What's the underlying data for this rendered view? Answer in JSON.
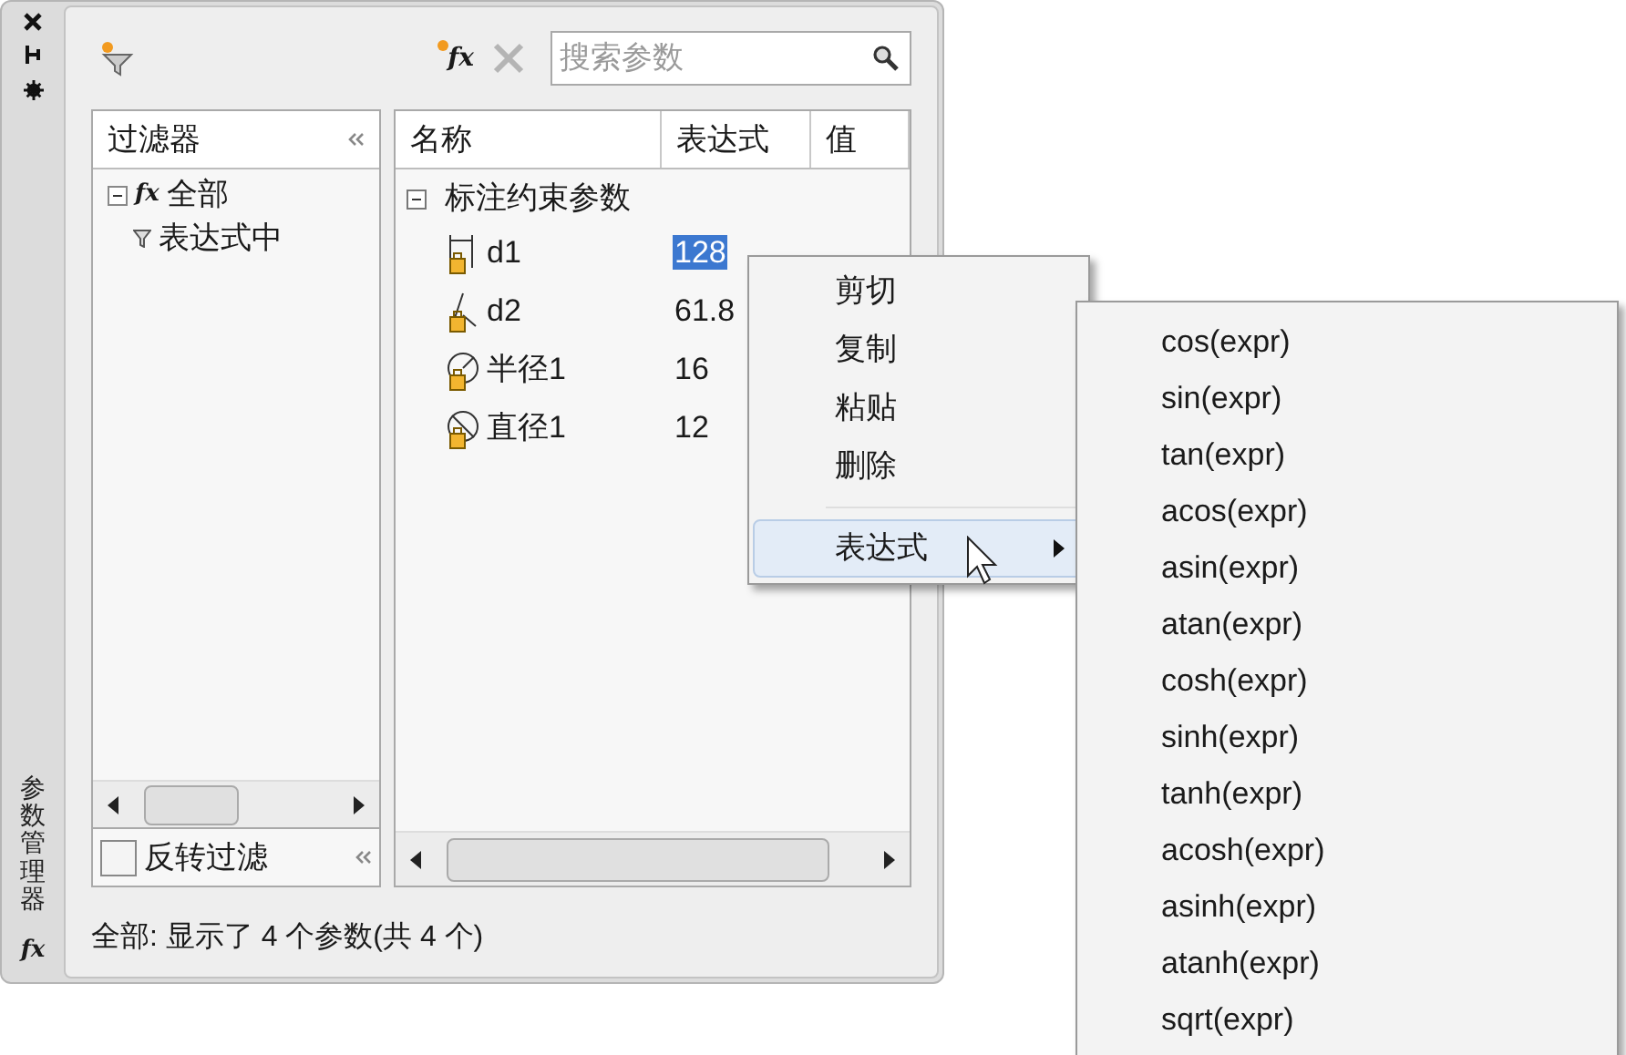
{
  "side_strip": {
    "title": "参数管理器",
    "fx": "fx"
  },
  "toolbar": {
    "search": {
      "placeholder": "搜索参数"
    },
    "fx_label": "fx"
  },
  "filter_pane": {
    "header": "过滤器",
    "tree": [
      {
        "icon": "fx",
        "label": "全部",
        "expanded": true,
        "children": [
          {
            "label": "表达式中"
          }
        ]
      }
    ],
    "invert": {
      "label": "反转过滤",
      "checked": false
    }
  },
  "table": {
    "columns": [
      "名称",
      "表达式",
      "值"
    ],
    "groups": [
      {
        "label": "标注约束参数",
        "expanded": true,
        "rows": [
          {
            "name": "d1",
            "expression": "128",
            "selected": true,
            "kind": "linear"
          },
          {
            "name": "d2",
            "expression": "61.8",
            "selected": false,
            "kind": "angular"
          },
          {
            "name": "半径1",
            "expression": "16",
            "selected": false,
            "kind": "radius"
          },
          {
            "name": "直径1",
            "expression": "12",
            "selected": false,
            "kind": "diameter"
          }
        ]
      }
    ]
  },
  "status_bar": "全部: 显示了 4 个参数(共 4 个)",
  "context_menu": [
    {
      "label": "剪切",
      "selected": false,
      "submenu": false
    },
    {
      "label": "复制",
      "selected": false,
      "submenu": false
    },
    {
      "label": "粘贴",
      "selected": false,
      "submenu": false
    },
    {
      "label": "删除",
      "selected": false,
      "submenu": false
    },
    {
      "label": "表达式",
      "selected": true,
      "submenu": true
    }
  ],
  "submenu": [
    "cos(expr)",
    "sin(expr)",
    "tan(expr)",
    "acos(expr)",
    "asin(expr)",
    "atan(expr)",
    "cosh(expr)",
    "sinh(expr)",
    "tanh(expr)",
    "acosh(expr)",
    "asinh(expr)",
    "atanh(expr)",
    "sqrt(expr)"
  ]
}
